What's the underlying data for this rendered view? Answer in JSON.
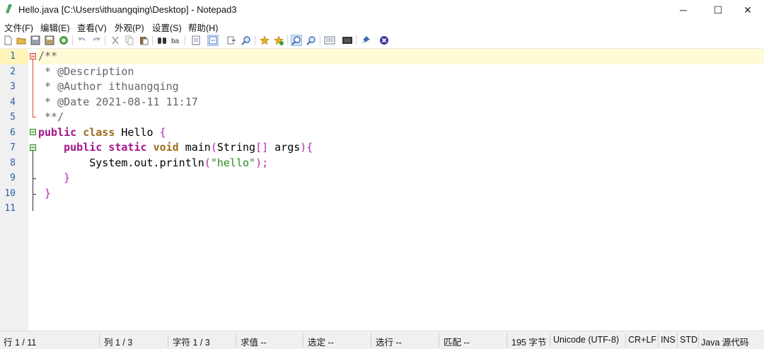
{
  "window": {
    "title": "Hello.java [C:\\Users\\ithuangqing\\Desktop] - Notepad3",
    "min_glyph": "─",
    "max_glyph": "☐",
    "close_glyph": "✕"
  },
  "menu": [
    "文件(F)",
    "编辑(E)",
    "查看(V)",
    "外观(P)",
    "设置(S)",
    "帮助(H)"
  ],
  "toolbar": [
    {
      "name": "new-file-icon",
      "color": "#ffffff"
    },
    {
      "name": "open-folder-icon",
      "color": "#e8b84a"
    },
    {
      "name": "save-icon",
      "color": "#5a7fbf"
    },
    {
      "name": "save-as-icon",
      "color": "#5a7fbf"
    },
    {
      "name": "browse-icon",
      "color": "#4a9a4a"
    },
    {
      "name": "undo-icon",
      "color": "#9aa8bb"
    },
    {
      "name": "redo-icon",
      "color": "#9aa8bb"
    },
    {
      "name": "cut-icon",
      "color": "#9aa0a8"
    },
    {
      "name": "copy-icon",
      "color": "#9aa0a8"
    },
    {
      "name": "paste-icon",
      "color": "#8a6a3a"
    },
    {
      "name": "find-icon",
      "color": "#333333"
    },
    {
      "name": "replace-icon",
      "color": "#333333"
    },
    {
      "name": "word-wrap-icon",
      "color": "#5a7fbf"
    },
    {
      "name": "view-whitespace-icon",
      "color": "#5a7fbf"
    },
    {
      "name": "goto-icon",
      "color": "#5a7fbf"
    },
    {
      "name": "zoom-search-icon",
      "color": "#3a6ab0"
    },
    {
      "name": "favorites-icon",
      "color": "#e8b020"
    },
    {
      "name": "add-favorite-icon",
      "color": "#e8b020"
    },
    {
      "name": "zoom-in-icon",
      "color": "#3a6ab0"
    },
    {
      "name": "zoom-out-icon",
      "color": "#3a6ab0"
    },
    {
      "name": "scheme-icon",
      "color": "#6a7a8a"
    },
    {
      "name": "customize-icon",
      "color": "#333333"
    },
    {
      "name": "pin-icon",
      "color": "#3a6ab0"
    },
    {
      "name": "exit-icon",
      "color": "#3a3aa0"
    }
  ],
  "editor": {
    "line_numbers": [
      "1",
      "2",
      "3",
      "4",
      "5",
      "6",
      "7",
      "8",
      "9",
      "10",
      "11"
    ],
    "lines": [
      [
        {
          "t": "/**",
          "c": "cm"
        }
      ],
      [
        {
          "t": " * @Description",
          "c": "cm"
        }
      ],
      [
        {
          "t": " * @Author ithuangqing",
          "c": "cm"
        }
      ],
      [
        {
          "t": " * @Date 2021-08-11 11:17",
          "c": "cm"
        }
      ],
      [
        {
          "t": " **/",
          "c": "cm"
        }
      ],
      [
        {
          "t": "public",
          "c": "mod"
        },
        {
          "t": " "
        },
        {
          "t": "class",
          "c": "kw"
        },
        {
          "t": " Hello "
        },
        {
          "t": "{",
          "c": "br"
        }
      ],
      [
        {
          "t": "    "
        },
        {
          "t": "public",
          "c": "mod"
        },
        {
          "t": " "
        },
        {
          "t": "static",
          "c": "mod"
        },
        {
          "t": " "
        },
        {
          "t": "void",
          "c": "kw"
        },
        {
          "t": " main"
        },
        {
          "t": "(",
          "c": "br"
        },
        {
          "t": "String"
        },
        {
          "t": "[]",
          "c": "br"
        },
        {
          "t": " args"
        },
        {
          "t": "){",
          "c": "br"
        }
      ],
      [
        {
          "t": "        System.out.println"
        },
        {
          "t": "(",
          "c": "br"
        },
        {
          "t": "\"hello\"",
          "c": "str"
        },
        {
          "t": ");",
          "c": "br"
        }
      ],
      [
        {
          "t": "    "
        },
        {
          "t": "}",
          "c": "br"
        }
      ],
      [
        {
          "t": " "
        },
        {
          "t": "}",
          "c": "br"
        }
      ],
      [
        {
          "t": ""
        }
      ]
    ]
  },
  "status": [
    "行 1 / 11",
    "列 1 / 3",
    "字符 1 / 3",
    "求值 --",
    "选定 --",
    "选行 --",
    "匹配 --",
    "195 字节",
    "Unicode (UTF-8)",
    "CR+LF",
    "INS",
    "STD",
    "Java 源代码"
  ]
}
